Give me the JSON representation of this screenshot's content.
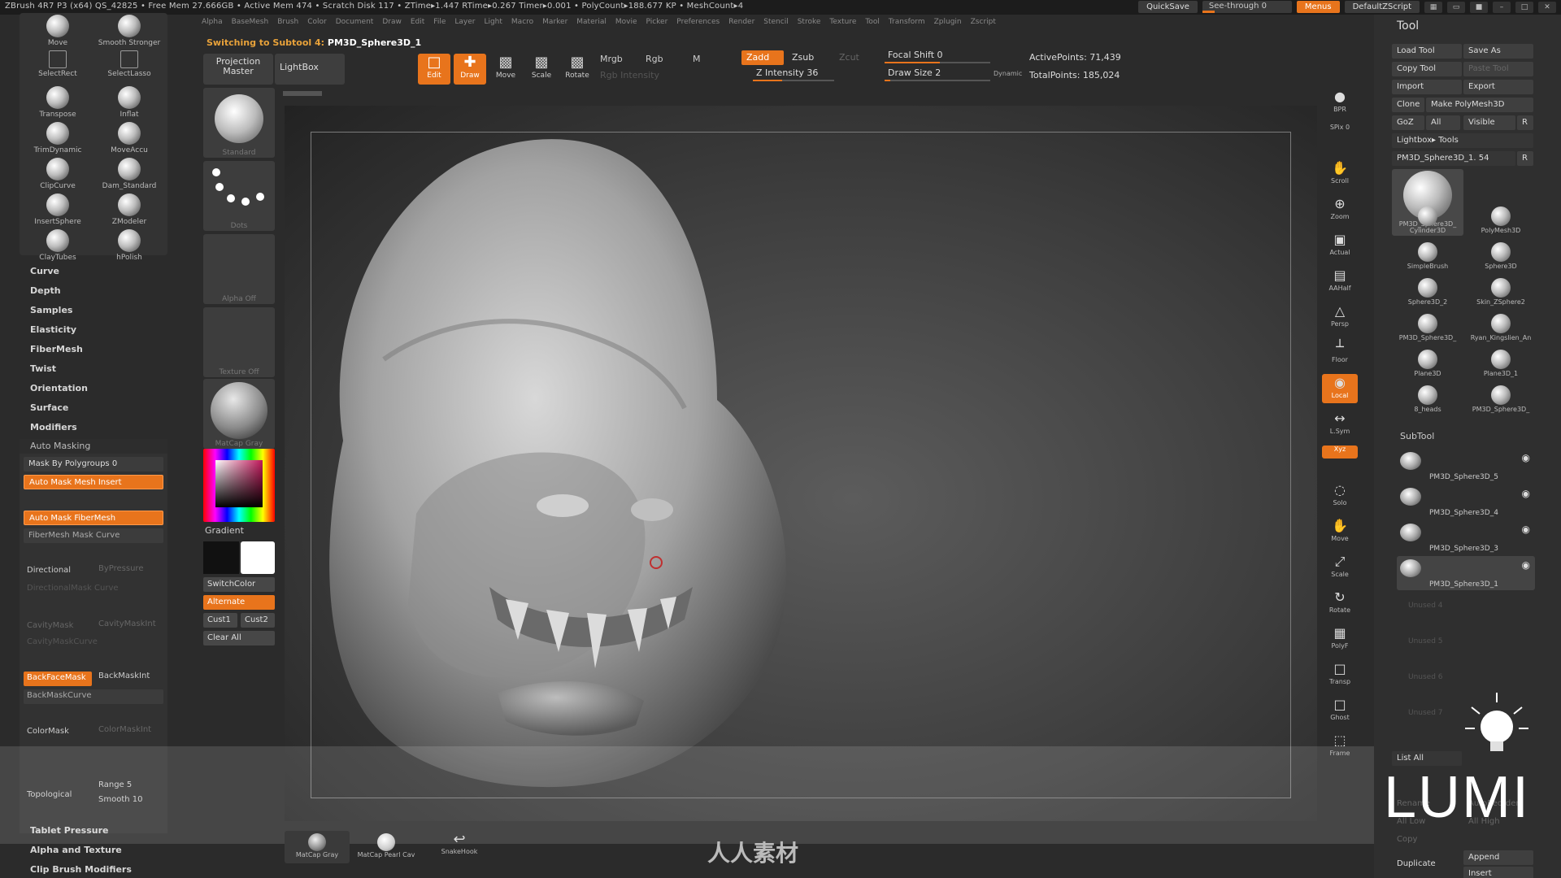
{
  "titlebar": {
    "stats": "ZBrush 4R7 P3 (x64)   QS_42825   • Free Mem 27.666GB • Active Mem 474 • Scratch Disk 117 • ZTime▸1.447 RTime▸0.267 Timer▸0.001 • PolyCount▸188.677 KP • MeshCount▸4",
    "quicksave": "QuickSave",
    "seethrough": "See-through  0",
    "menus": "Menus",
    "script": "DefaultZScript"
  },
  "menubar": [
    "Alpha",
    "BaseMesh",
    "Brush",
    "Color",
    "Document",
    "Draw",
    "Edit",
    "File",
    "Layer",
    "Light",
    "Macro",
    "Marker",
    "Material",
    "Movie",
    "Picker",
    "Preferences",
    "Render",
    "Stencil",
    "Stroke",
    "Texture",
    "Tool",
    "Transform",
    "Zplugin",
    "Zscript"
  ],
  "brushes": [
    {
      "label": "Move"
    },
    {
      "label": "Smooth Stronger"
    },
    {
      "label": "SelectRect"
    },
    {
      "label": "SelectLasso"
    },
    {
      "label": "Transpose"
    },
    {
      "label": "Inflat"
    },
    {
      "label": "TrimDynamic"
    },
    {
      "label": "MoveAccu"
    },
    {
      "label": "ClipCurve"
    },
    {
      "label": "Dam_Standard"
    },
    {
      "label": "InsertSphere"
    },
    {
      "label": "ZModeler"
    },
    {
      "label": "ClayTubes"
    },
    {
      "label": "hPolish"
    }
  ],
  "leftmenu": [
    "Curve",
    "Depth",
    "Samples",
    "Elasticity",
    "FiberMesh",
    "Twist",
    "Orientation",
    "Surface",
    "Modifiers"
  ],
  "automask": {
    "title": "Auto Masking",
    "mask_by_polygroups": "Mask By Polygroups 0",
    "auto_mask_mesh_insert": "Auto Mask Mesh Insert",
    "auto_mask_fibermesh": "Auto Mask FiberMesh",
    "fibermesh_mask_curve": "FiberMesh Mask Curve",
    "directional": "Directional",
    "bypressure": "ByPressure",
    "directionalmask_curve": "DirectionalMask Curve",
    "cavitymask": "CavityMask",
    "cavitymaskint": "CavityMaskInt",
    "cavitymask_curve": "CavityMaskCurve",
    "backfacemask": "BackFaceMask",
    "backmaskint": "BackMaskInt",
    "backmask_curve": "BackMaskCurve",
    "colormask": "ColorMask",
    "colormaskint": "ColorMaskInt",
    "topological": "Topological",
    "range": "Range 5",
    "smooth": "Smooth 10"
  },
  "bottommenu": [
    "Tablet Pressure",
    "Alpha and Texture",
    "Clip Brush Modifiers"
  ],
  "shelf": {
    "standard": "Standard",
    "dots": "Dots",
    "alpha_off": "Alpha Off",
    "texture_off": "Texture Off",
    "matcap_gray": "MatCap Gray",
    "gradient": "Gradient",
    "switchcolor": "SwitchColor",
    "alternate": "Alternate",
    "cust1": "Cust1",
    "cust2": "Cust2",
    "clear_all": "Clear All"
  },
  "topbar": {
    "switching": "Switching to Subtool 4:",
    "subtool_name": "PM3D_Sphere3D_1",
    "projection_master": "Projection Master",
    "lightbox": "LightBox",
    "edit": "Edit",
    "draw": "Draw",
    "move": "Move",
    "scale": "Scale",
    "rotate": "Rotate",
    "mrgb": "Mrgb",
    "rgb": "Rgb",
    "m": "M",
    "rgb_intensity": "Rgb Intensity",
    "zadd": "Zadd",
    "zsub": "Zsub",
    "zcut": "Zcut",
    "z_intensity": "Z Intensity 36",
    "z_intensity_level": 0.36,
    "focal_shift": "Focal Shift 0",
    "draw_size": "Draw Size 2",
    "dynamic": "Dynamic",
    "active_points": "ActivePoints: 71,439",
    "total_points": "TotalPoints: 185,024"
  },
  "rightbar": [
    {
      "label": "BPR",
      "glyph": "●"
    },
    {
      "label": "SPix 0",
      "glyph": ""
    },
    {
      "label": "Scroll",
      "glyph": "✋"
    },
    {
      "label": "Zoom",
      "glyph": "⊕"
    },
    {
      "label": "Actual",
      "glyph": "▣"
    },
    {
      "label": "AAHalf",
      "glyph": "▤"
    },
    {
      "label": "Persp",
      "glyph": "△"
    },
    {
      "label": "Floor",
      "glyph": "┴"
    },
    {
      "label": "Local",
      "glyph": "◉"
    },
    {
      "label": "L.Sym",
      "glyph": "↔"
    },
    {
      "label": "Xyz",
      "glyph": ""
    },
    {
      "label": "Solo",
      "glyph": "◌"
    },
    {
      "label": "Move",
      "glyph": "✋"
    },
    {
      "label": "Scale",
      "glyph": "⤢"
    },
    {
      "label": "Rotate",
      "glyph": "↻"
    },
    {
      "label": "PolyF",
      "glyph": "▦"
    },
    {
      "label": "Transp",
      "glyph": "□"
    },
    {
      "label": "Ghost",
      "glyph": "□"
    },
    {
      "label": "Frame",
      "glyph": "⬚"
    }
  ],
  "toolpalette": {
    "title": "Tool",
    "load_tool": "Load Tool",
    "save_as": "Save As",
    "copy_tool": "Copy Tool",
    "paste_tool": "Paste Tool",
    "import": "Import",
    "export": "Export",
    "clone": "Clone",
    "make_polymesh": "Make PolyMesh3D",
    "goz": "GoZ",
    "all": "All",
    "visible": "Visible",
    "r": "R",
    "lightbox_tools": "Lightbox▸ Tools",
    "current_tool": "PM3D_Sphere3D_1. 54",
    "tools": [
      {
        "label": "PM3D_Sphere3D_"
      },
      {
        "label": "Cylinder3D"
      },
      {
        "label": "PolyMesh3D"
      },
      {
        "label": "SimpleBrush"
      },
      {
        "label": "Sphere3D"
      },
      {
        "label": "Sphere3D_2"
      },
      {
        "label": "Skin_ZSphere2"
      },
      {
        "label": "PM3D_Sphere3D_"
      },
      {
        "label": "Ryan_Kingslien_An"
      },
      {
        "label": "Plane3D"
      },
      {
        "label": "Plane3D_1"
      },
      {
        "label": "8_heads"
      },
      {
        "label": "PM3D_Sphere3D_"
      }
    ],
    "subtool_title": "SubTool",
    "subtools": [
      {
        "label": "PM3D_Sphere3D_5"
      },
      {
        "label": "PM3D_Sphere3D_4"
      },
      {
        "label": "PM3D_Sphere3D_3"
      },
      {
        "label": "PM3D_Sphere3D_1"
      }
    ],
    "unused": [
      "Unused 4",
      "Unused 5",
      "Unused 6",
      "Unused 7"
    ],
    "list_all": "List All",
    "rename": "Rename",
    "autoreorder": "AutoReorder",
    "all_low": "All Low",
    "all_high": "All High",
    "copy": "Copy",
    "duplicate": "Duplicate",
    "append": "Append",
    "insert": "Insert"
  },
  "bottom_materials": [
    {
      "label": "MatCap Gray"
    },
    {
      "label": "MatCap Pearl Cav"
    },
    {
      "label": "SnakeHook"
    }
  ],
  "overlay": {
    "lumi": "LUMI",
    "watermark": "人人素材"
  }
}
